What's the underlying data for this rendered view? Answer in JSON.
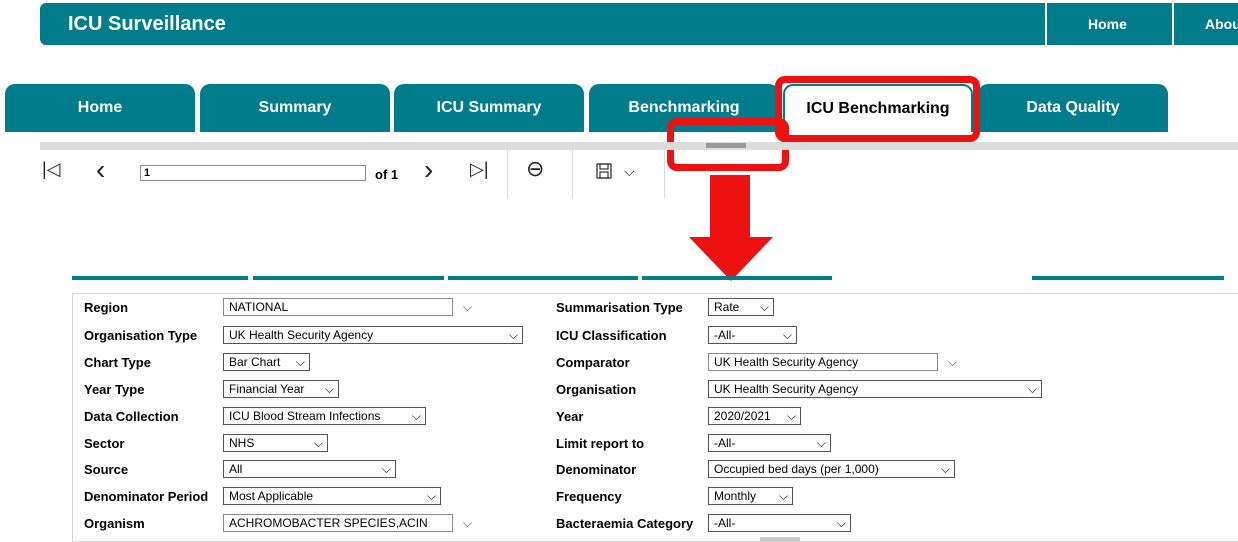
{
  "header": {
    "title": "ICU Surveillance",
    "links": [
      "Home",
      "Abou"
    ]
  },
  "tabs": [
    "Home",
    "Summary",
    "ICU Summary",
    "Benchmarking",
    "ICU Benchmarking",
    "Data Quality"
  ],
  "active_tab": "ICU Benchmarking",
  "toolbar": {
    "first_icon": "|◁",
    "prev_icon": "‹",
    "page_value": "1",
    "of_label": "of 1",
    "next_icon": "›",
    "last_icon": "▷|",
    "back_icon": "⊖",
    "save_icon": "save-icon",
    "dropdown_icon": "⌵"
  },
  "annotations": {
    "highlight_color": "#ee1111",
    "arrow_color": "#ee1111"
  },
  "colors": {
    "brand": "#007c8a"
  },
  "params": {
    "left": [
      {
        "label": "Region",
        "value": "NATIONAL"
      },
      {
        "label": "Organisation Type",
        "value": "UK Health Security Agency"
      },
      {
        "label": "Chart Type",
        "value": "Bar Chart"
      },
      {
        "label": "Year Type",
        "value": "Financial Year"
      },
      {
        "label": "Data Collection",
        "value": "ICU Blood Stream Infections"
      },
      {
        "label": "Sector",
        "value": "NHS"
      },
      {
        "label": "Source",
        "value": "All"
      },
      {
        "label": "Denominator Period",
        "value": "Most Applicable"
      },
      {
        "label": "Organism",
        "value": "ACHROMOBACTER SPECIES,ACIN"
      }
    ],
    "right": [
      {
        "label": "Summarisation Type",
        "value": "Rate"
      },
      {
        "label": "ICU Classification",
        "value": "-All-"
      },
      {
        "label": "Comparator",
        "value": "UK Health Security Agency"
      },
      {
        "label": "Organisation",
        "value": "UK Health Security Agency"
      },
      {
        "label": "Year",
        "value": "2020/2021"
      },
      {
        "label": "Limit report to",
        "value": "-All-"
      },
      {
        "label": "Denominator",
        "value": "Occupied bed days (per 1,000)"
      },
      {
        "label": "Frequency",
        "value": "Monthly"
      },
      {
        "label": "Bacteraemia Category",
        "value": "-All-"
      }
    ]
  }
}
